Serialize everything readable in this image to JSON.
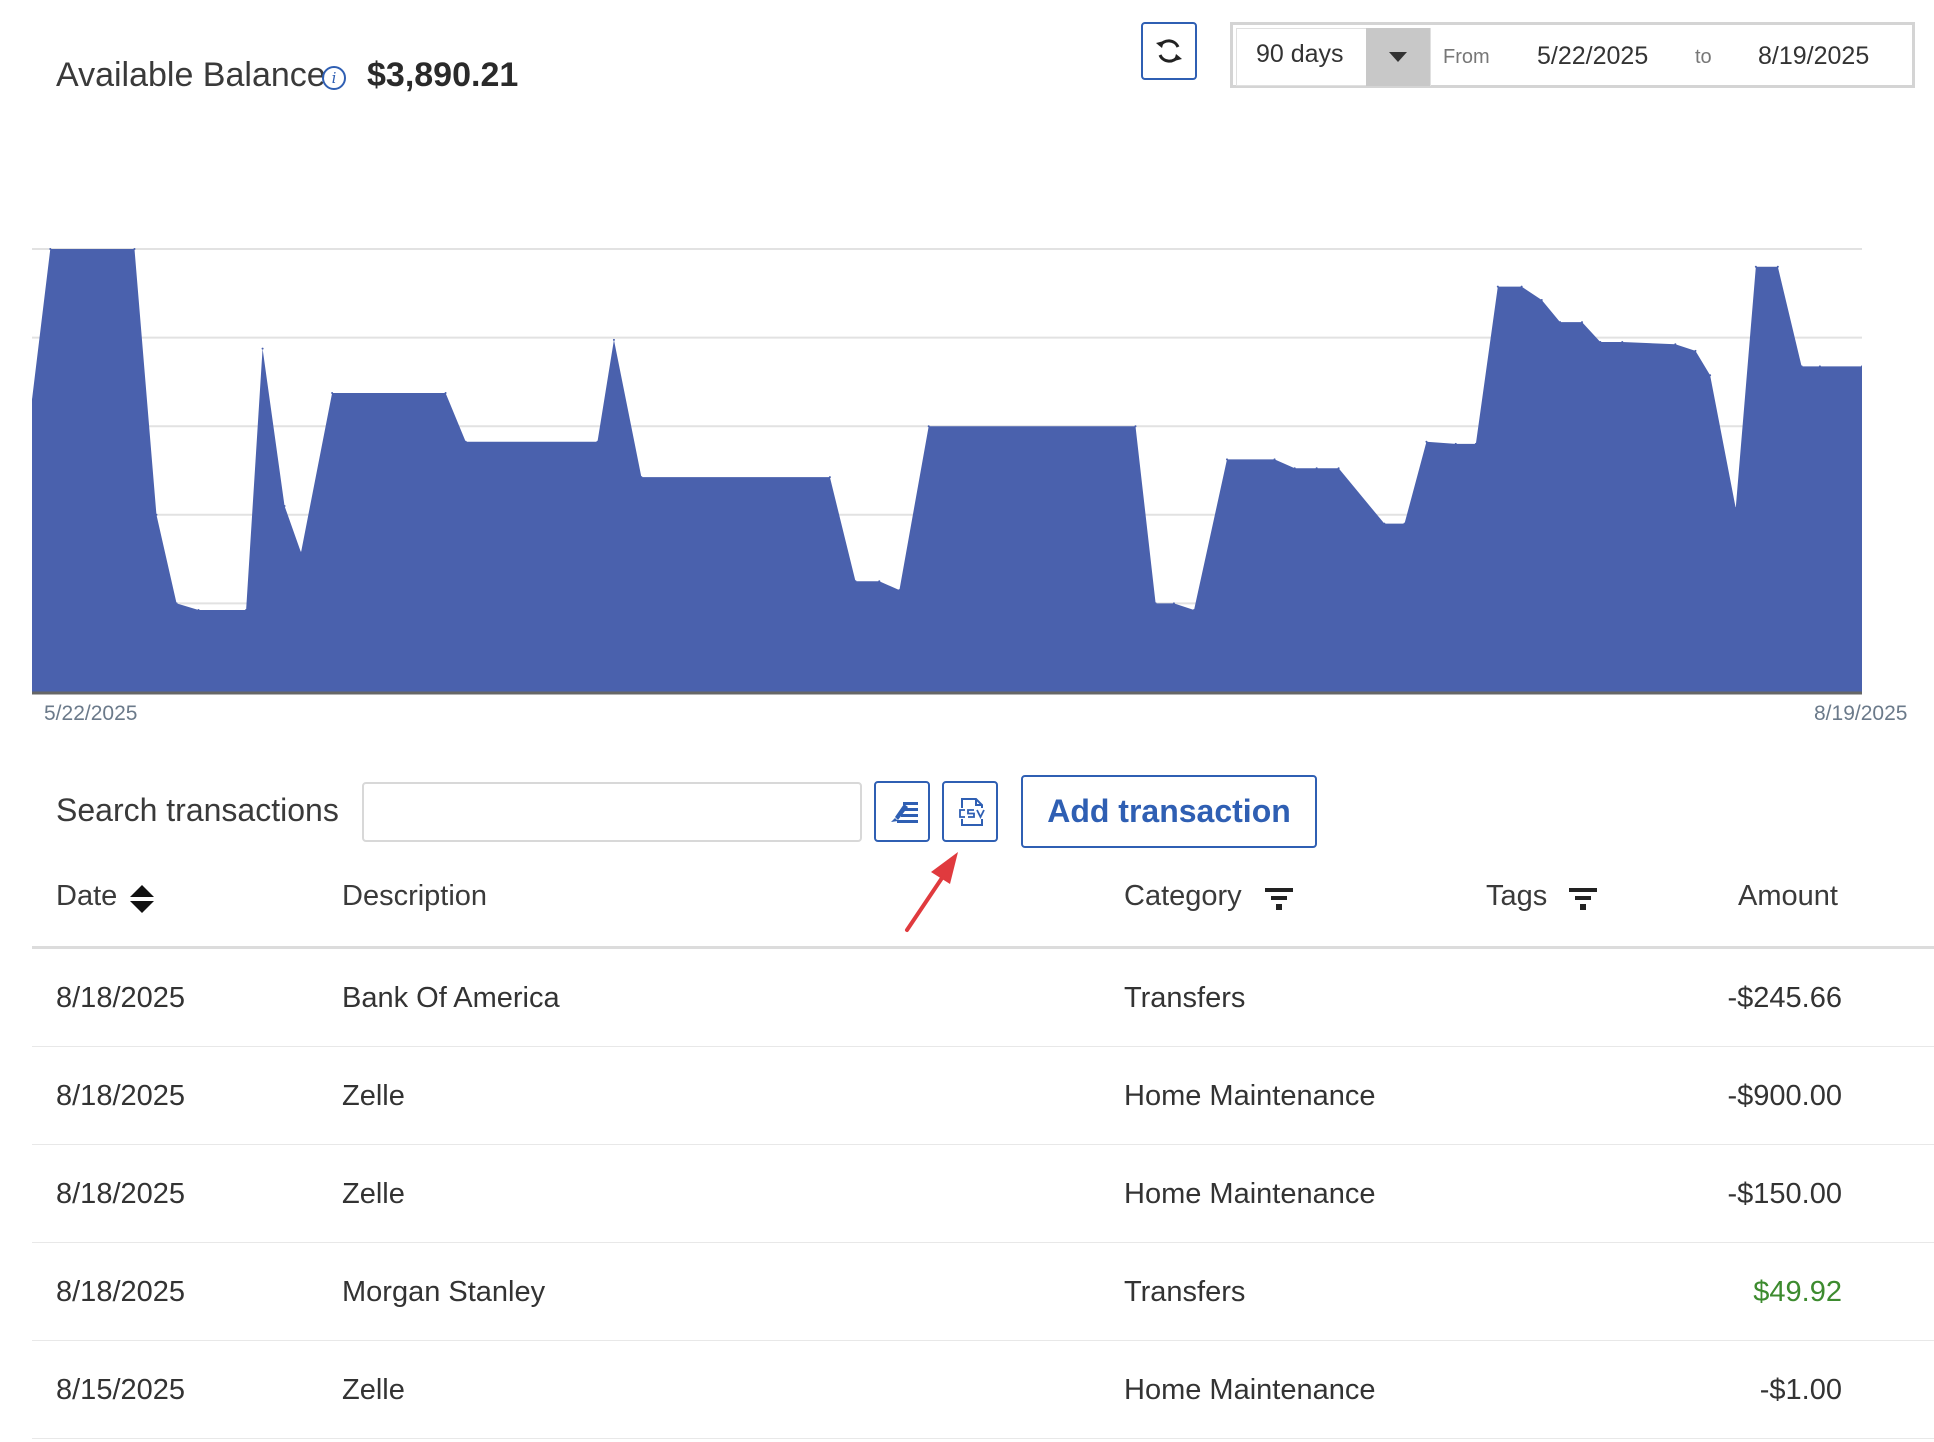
{
  "header": {
    "balance_label": "Available Balance",
    "info_icon": "i",
    "balance_value": "$3,890.21"
  },
  "controls": {
    "refresh_icon": "refresh-icon",
    "range_label": "90 days",
    "from_label": "From",
    "from_date": "5/22/2025",
    "to_label": "to",
    "to_date": "8/19/2025"
  },
  "chart_data": {
    "type": "area",
    "x_start_label": "5/22/2025",
    "x_end_label": "8/19/2025",
    "grid": true,
    "ylim": [
      0,
      100
    ],
    "color": "#4a61ad",
    "x": [
      0,
      1,
      5.6,
      6.8,
      7.9,
      9.1,
      11.7,
      12.6,
      13.8,
      14.7,
      16.4,
      22.6,
      23.7,
      30.9,
      31.8,
      33.3,
      43.6,
      45.0,
      46.3,
      47.4,
      49.0,
      60.3,
      61.4,
      62.4,
      63.5,
      65.3,
      67.9,
      69.0,
      70.2,
      71.4,
      73.9,
      75.0,
      76.2,
      77.8,
      78.9,
      80.1,
      81.4,
      82.5,
      83.5,
      84.7,
      85.7,
      86.9,
      89.8,
      90.9,
      91.7,
      93.1,
      94.2,
      95.4,
      96.7,
      97.7,
      100
    ],
    "values": [
      66,
      100,
      100,
      40,
      20,
      18.5,
      18.5,
      77.5,
      42,
      31.5,
      67.5,
      67.5,
      56.5,
      56.5,
      79.5,
      48.5,
      48.5,
      25,
      25,
      23,
      60,
      60,
      20,
      20,
      18.5,
      52.5,
      52.5,
      50.5,
      50.5,
      50.5,
      38,
      38,
      56.5,
      56,
      56,
      91.5,
      91.5,
      88.5,
      83.5,
      83.5,
      79,
      79,
      78.5,
      77,
      71.5,
      41.5,
      96,
      96,
      73.5,
      73.5,
      73.5
    ]
  },
  "toolbar": {
    "search_label": "Search transactions",
    "search_value": "",
    "add_button": "Add transaction"
  },
  "table": {
    "headers": {
      "date": "Date",
      "description": "Description",
      "category": "Category",
      "tags": "Tags",
      "amount": "Amount"
    },
    "rows": [
      {
        "date": "8/18/2025",
        "description": "Bank Of America",
        "category": "Transfers",
        "amount": "-$245.66"
      },
      {
        "date": "8/18/2025",
        "description": "Zelle",
        "category": "Home Maintenance",
        "amount": "-$900.00"
      },
      {
        "date": "8/18/2025",
        "description": "Zelle",
        "category": "Home Maintenance",
        "amount": "-$150.00"
      },
      {
        "date": "8/18/2025",
        "description": "Morgan Stanley",
        "category": "Transfers",
        "amount": "$49.92"
      },
      {
        "date": "8/15/2025",
        "description": "Zelle",
        "category": "Home Maintenance",
        "amount": "-$1.00"
      }
    ]
  },
  "colors": {
    "accent": "#2f5fb3",
    "chart_fill": "#4a61ad",
    "positive": "#3d8b2f",
    "annotation": "#e03a3e"
  }
}
